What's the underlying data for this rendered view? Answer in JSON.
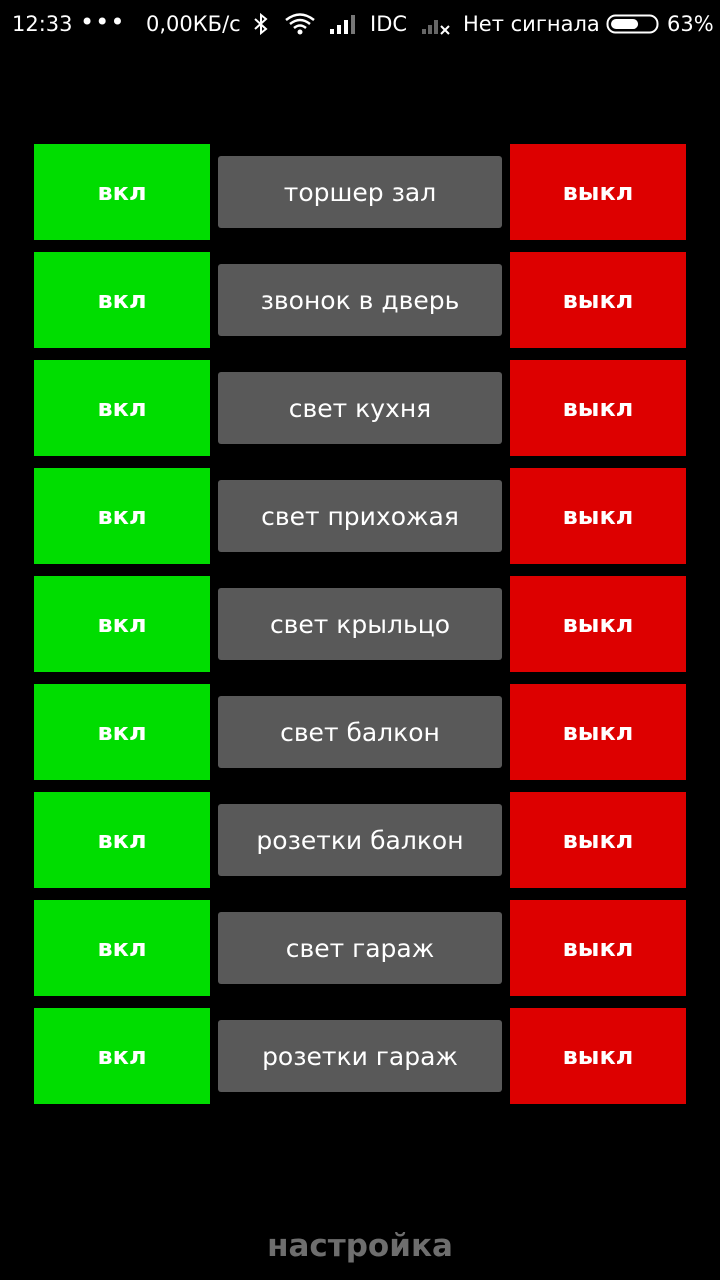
{
  "status_bar": {
    "time": "12:33",
    "dots": "•••",
    "speed": "0,00КБ/с",
    "carrier": "IDC",
    "no_signal": "Нет сигнала",
    "battery_pct": "63%",
    "battery_level": 0.63,
    "icons": [
      "bluetooth-icon",
      "wifi-icon",
      "signal-icon",
      "no-signal-icon",
      "battery-icon"
    ]
  },
  "controls": {
    "on_label": "вкл",
    "off_label": "выкл",
    "on_color": "#00DD00",
    "off_color": "#DD0000",
    "label_bg": "#595959",
    "items": [
      {
        "name": "торшер зал"
      },
      {
        "name": "звонок в дверь"
      },
      {
        "name": "свет кухня"
      },
      {
        "name": "свет прихожая"
      },
      {
        "name": "свет крыльцо"
      },
      {
        "name": "свет балкон"
      },
      {
        "name": "розетки балкон"
      },
      {
        "name": "свет гараж"
      },
      {
        "name": "розетки гараж"
      }
    ]
  },
  "footer": {
    "settings_label": "настройка"
  }
}
